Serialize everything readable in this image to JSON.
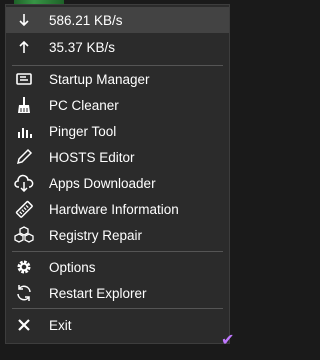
{
  "speed": {
    "download": "586.21 KB/s",
    "upload": "35.37 KB/s",
    "download_icon": "arrow-down-icon",
    "upload_icon": "arrow-up-icon"
  },
  "tools": [
    {
      "label": "Startup Manager",
      "icon": "startup-manager-icon"
    },
    {
      "label": "PC Cleaner",
      "icon": "broom-icon"
    },
    {
      "label": "Pinger Tool",
      "icon": "bars-icon"
    },
    {
      "label": "HOSTS Editor",
      "icon": "pencil-icon"
    },
    {
      "label": "Apps Downloader",
      "icon": "cloud-download-icon"
    },
    {
      "label": "Hardware Information",
      "icon": "memory-stick-icon"
    },
    {
      "label": "Registry Repair",
      "icon": "cubes-icon"
    }
  ],
  "system": [
    {
      "label": "Options",
      "icon": "gear-icon"
    },
    {
      "label": "Restart Explorer",
      "icon": "refresh-icon"
    }
  ],
  "exit": {
    "label": "Exit",
    "icon": "close-icon"
  },
  "colors": {
    "menu_bg": "#2b2b2b",
    "highlight": "#434343",
    "accent_check": "#c078ff",
    "tray_green": "#3aa24a"
  }
}
